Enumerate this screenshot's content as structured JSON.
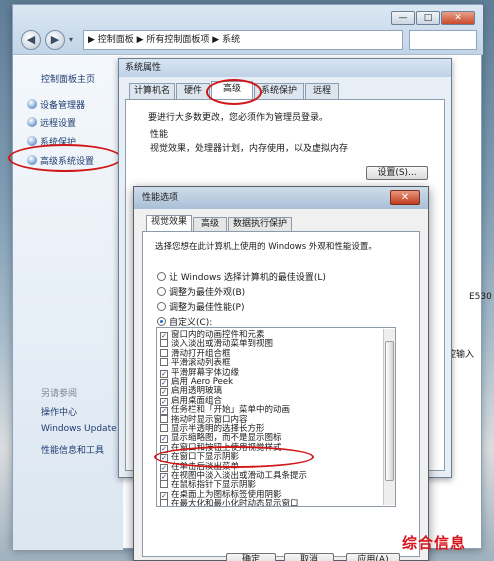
{
  "explorer": {
    "address": "▶ 控制面板 ▶ 所有控制面板项 ▶ 系统",
    "window_buttons": [
      "—",
      "□",
      "✕"
    ]
  },
  "left_pane": {
    "home": "控制面板主页",
    "items": [
      "设备管理器",
      "远程设置",
      "系统保护",
      "高级系统设置"
    ],
    "see_also_label": "另请参阅",
    "see_also": [
      "操作中心",
      "Windows Update",
      "性能信息和工具"
    ]
  },
  "right_fragments": [
    "E530",
    "控输入"
  ],
  "sysprops": {
    "title": "系统属性",
    "tabs": [
      "计算机名",
      "硬件",
      "高级",
      "系统保护",
      "远程"
    ],
    "admin_note": "要进行大多数更改，您必须作为管理员登录。",
    "perf_heading": "性能",
    "perf_desc": "视觉效果，处理器计划，内存使用，以及虚拟内存",
    "settings_button": "设置(S)..."
  },
  "perfopts": {
    "title": "性能选项",
    "close": "✕",
    "tabs": [
      "视觉效果",
      "高级",
      "数据执行保护"
    ],
    "intro": "选择您想在此计算机上使用的 Windows 外观和性能设置。",
    "radios": [
      {
        "label": "让 Windows 选择计算机的最佳设置(L)",
        "selected": false
      },
      {
        "label": "调整为最佳外观(B)",
        "selected": false
      },
      {
        "label": "调整为最佳性能(P)",
        "selected": false
      },
      {
        "label": "自定义(C):",
        "selected": true
      }
    ],
    "options": [
      {
        "label": "窗口内的动画控件和元素",
        "checked": true
      },
      {
        "label": "淡入淡出或滑动菜单到视图",
        "checked": false
      },
      {
        "label": "滑动打开组合框",
        "checked": false
      },
      {
        "label": "平滑滚动列表框",
        "checked": false
      },
      {
        "label": "平滑屏幕字体边缘",
        "checked": true
      },
      {
        "label": "启用 Aero Peek",
        "checked": true
      },
      {
        "label": "启用透明玻璃",
        "checked": true
      },
      {
        "label": "启用桌面组合",
        "checked": true
      },
      {
        "label": "任务栏和「开始」菜单中的动画",
        "checked": true
      },
      {
        "label": "拖动时显示窗口内容",
        "checked": false
      },
      {
        "label": "显示半透明的选择长方形",
        "checked": false
      },
      {
        "label": "显示缩略图，而不是显示图标",
        "checked": true
      },
      {
        "label": "在窗口和按钮上使用视觉样式",
        "checked": true
      },
      {
        "label": "在窗口下显示阴影",
        "checked": true
      },
      {
        "label": "在单击后淡出菜单",
        "checked": true
      },
      {
        "label": "在视图中淡入淡出或滑动工具条提示",
        "checked": true
      },
      {
        "label": "在鼠标指针下显示阴影",
        "checked": false
      },
      {
        "label": "在桌面上为图标标签使用阴影",
        "checked": true
      },
      {
        "label": "在最大化和最小化时动态显示窗口",
        "checked": false
      }
    ],
    "buttons": [
      "确定",
      "取消",
      "应用(A)"
    ]
  },
  "watermark": "综合信息",
  "colors": {
    "highlight_ring": "#d11818",
    "watermark": "#d8141c"
  }
}
